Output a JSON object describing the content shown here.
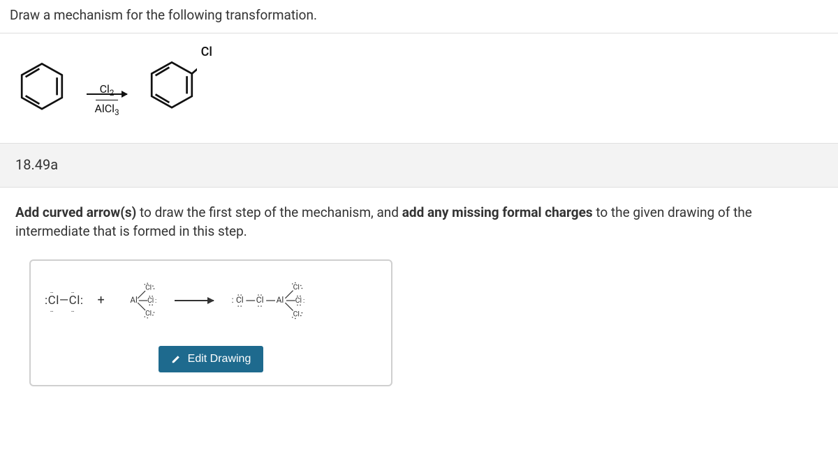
{
  "question": {
    "prompt": "Draw a mechanism for the following transformation.",
    "reaction": {
      "reagent_top": "Cl2",
      "reagent_bottom": "AlCl3",
      "product_substituent": "Cl"
    }
  },
  "section_number": "18.49a",
  "instruction": {
    "part1_bold": "Add curved arrow(s)",
    "part1_rest": " to draw the first step of the mechanism, and ",
    "part2_bold": "add any missing formal charges",
    "part2_rest": " to the given drawing of the intermediate that is formed in this step."
  },
  "mechanism": {
    "reactant1": ":Cl—Cl:",
    "plus": "+",
    "reactant2_center": "Al",
    "reactant2_ligand": "Cl",
    "product_left": ":Cl—Cl—Al",
    "product_ligand": "Cl"
  },
  "buttons": {
    "edit_drawing": "Edit Drawing"
  }
}
